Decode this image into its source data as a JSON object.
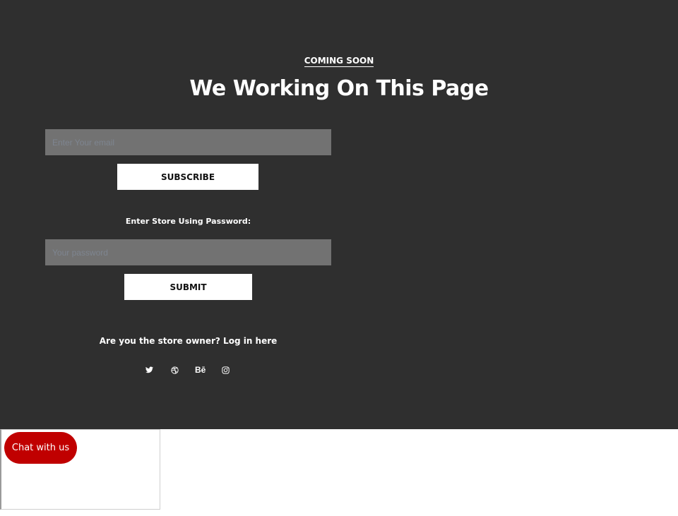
{
  "hero": {
    "eyebrow": "COMING SOON",
    "title": "We Working On This Page"
  },
  "newsletter": {
    "email_placeholder": "Enter Your email",
    "email_value": "",
    "subscribe_label": "SUBSCRIBE"
  },
  "password_form": {
    "label": "Enter Store Using Password:",
    "password_placeholder": "Your password",
    "password_value": "",
    "submit_label": "SUBMIT"
  },
  "owner_login": {
    "text": "Are you the store owner? Log in here"
  },
  "social": [
    {
      "name": "twitter-icon",
      "glyph": "🐦"
    },
    {
      "name": "dribbble-icon",
      "glyph": "◎"
    },
    {
      "name": "behance-icon",
      "glyph": "Bē"
    },
    {
      "name": "instagram-icon",
      "glyph": "◙"
    }
  ],
  "chat": {
    "label": "Chat with us",
    "color": "#c00000"
  },
  "colors": {
    "background": "#2f2f2f",
    "input_bg": "#727272",
    "button_bg": "#ffffff"
  }
}
